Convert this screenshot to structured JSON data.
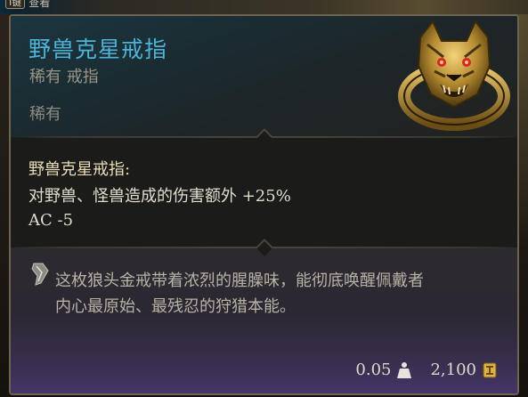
{
  "top_hint": {
    "key": "I键",
    "label": "查看"
  },
  "item": {
    "name": "野兽克星戒指",
    "subtitle": "稀有 戒指",
    "rarity": "稀有",
    "effect_title": "野兽克星戒指:",
    "effects": [
      "对野兽、怪兽造成的伤害额外 +25%",
      "AC -5"
    ],
    "description_lines": [
      "这枚狼头金戒带着浓烈的腥臊味，能彻底唤醒佩戴者",
      "内心最原始、最残忍的狩猎本能。"
    ],
    "weight": "0.05",
    "value": "2,100"
  },
  "icons": {
    "item_art": "wolf-head-ring-icon",
    "description": "quill-icon",
    "weight": "weight-icon",
    "value": "gold-coin-icon"
  },
  "colors": {
    "name": "#4fb3d9",
    "rarity": "#8f8a80",
    "effect_title": "#e8dcb8"
  }
}
